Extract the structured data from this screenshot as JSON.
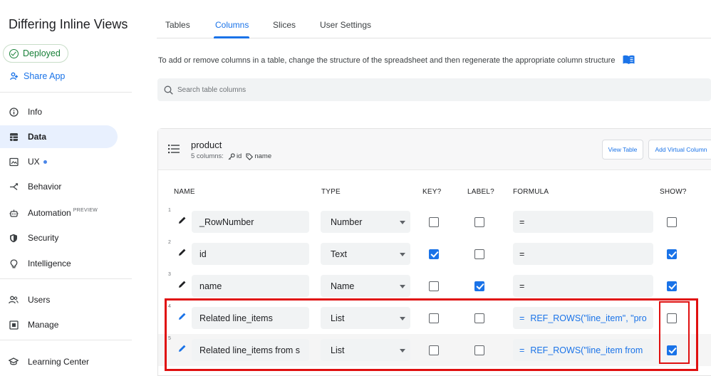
{
  "app": {
    "title": "Differing Inline Views",
    "status": "Deployed",
    "share_label": "Share App"
  },
  "sidebar": {
    "items": [
      {
        "label": "Info",
        "icon": "info-icon"
      },
      {
        "label": "Data",
        "icon": "data-icon",
        "active": true
      },
      {
        "label": "UX",
        "icon": "ux-icon",
        "dot": true
      },
      {
        "label": "Behavior",
        "icon": "behavior-icon"
      },
      {
        "label": "Automation",
        "icon": "automation-icon",
        "badge": "PREVIEW"
      },
      {
        "label": "Security",
        "icon": "security-icon"
      },
      {
        "label": "Intelligence",
        "icon": "intelligence-icon"
      },
      {
        "label": "Users",
        "icon": "users-icon"
      },
      {
        "label": "Manage",
        "icon": "manage-icon"
      },
      {
        "label": "Learning Center",
        "icon": "learning-center-icon"
      }
    ]
  },
  "tabs": [
    {
      "label": "Tables"
    },
    {
      "label": "Columns",
      "active": true
    },
    {
      "label": "Slices"
    },
    {
      "label": "User Settings"
    }
  ],
  "info_text": "To add or remove columns in a table, change the structure of the spreadsheet and then regenerate the appropriate column structure",
  "search": {
    "placeholder": "Search table columns"
  },
  "table": {
    "name": "product",
    "column_count": "5 columns:",
    "key_tag": "id",
    "label_tag": "name",
    "view_button": "View Table",
    "add_virtual_button": "Add Virtual Column",
    "headers": {
      "name": "NAME",
      "type": "TYPE",
      "key": "KEY?",
      "label": "LABEL?",
      "formula": "FORMULA",
      "show": "SHOW?"
    },
    "rows": [
      {
        "num": "1",
        "name": "_RowNumber",
        "type": "Number",
        "key": false,
        "label": false,
        "formula_prefix": "=",
        "formula": "",
        "show": false
      },
      {
        "num": "2",
        "name": "id",
        "type": "Text",
        "key": true,
        "label": false,
        "formula_prefix": "=",
        "formula": "",
        "show": true
      },
      {
        "num": "3",
        "name": "name",
        "type": "Name",
        "key": false,
        "label": true,
        "formula_prefix": "=",
        "formula": "",
        "show": true
      },
      {
        "num": "4",
        "name": "Related line_items",
        "type": "List",
        "key": false,
        "label": false,
        "formula_prefix": "=",
        "formula": "REF_ROWS(\"line_item\", \"pro",
        "show": false
      },
      {
        "num": "5",
        "name": "Related line_items from s",
        "type": "List",
        "key": false,
        "label": false,
        "formula_prefix": "=",
        "formula": "REF_ROWS(\"line_item from",
        "show": true
      }
    ]
  },
  "colors": {
    "accent": "#1a73e8",
    "deployed": "#188038",
    "highlight": "#e01010"
  }
}
